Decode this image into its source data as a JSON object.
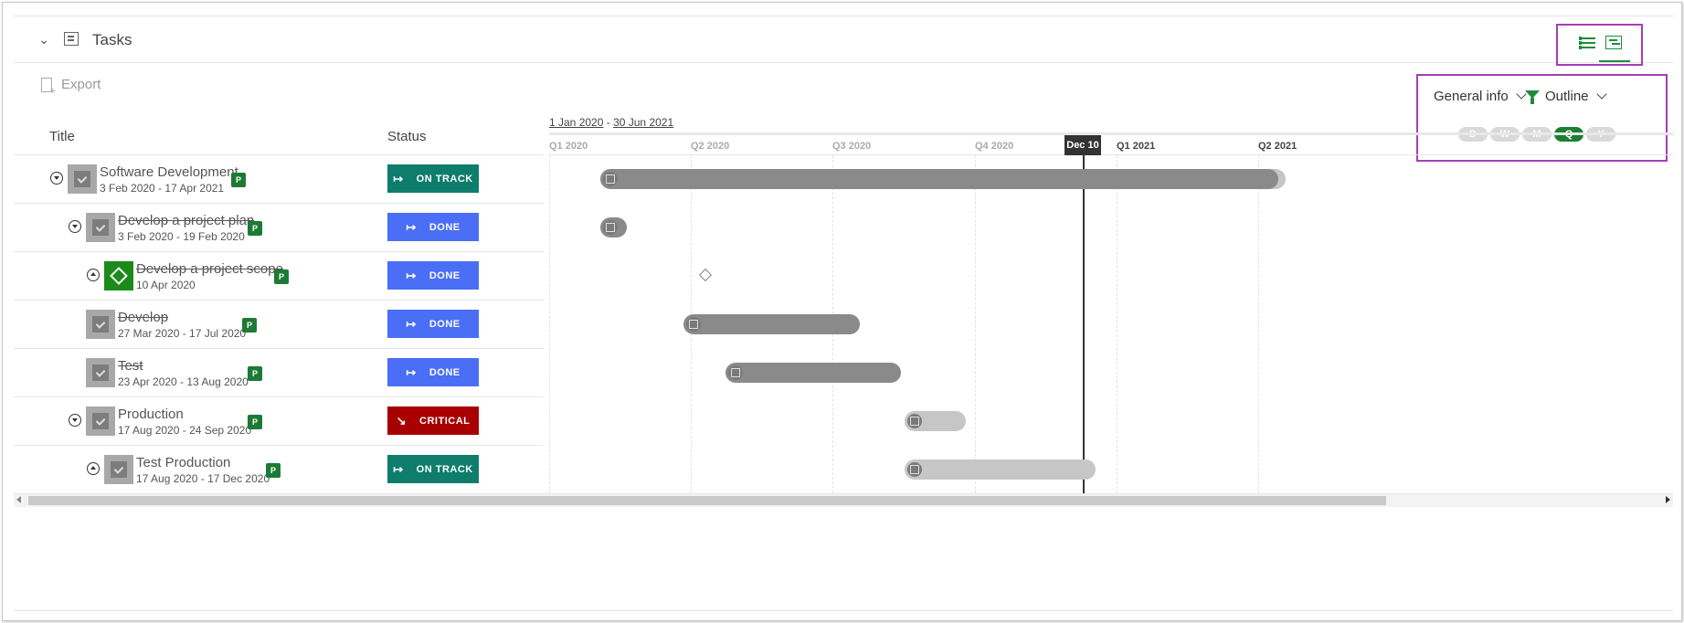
{
  "panel": {
    "title": "Tasks",
    "export_label": "Export"
  },
  "controls": {
    "info_label": "General info",
    "outline_label": "Outline",
    "scale": [
      "D",
      "W",
      "M",
      "Q",
      "Y"
    ],
    "scale_active": "Q"
  },
  "columns": {
    "title": "Title",
    "status": "Status"
  },
  "timeline": {
    "range_start": "1 Jan 2020",
    "range_separator": "-",
    "range_end": "30 Jun 2021",
    "quarters": [
      "Q1 2020",
      "Q2 2020",
      "Q3 2020",
      "Q4 2020",
      "Q1 2021",
      "Q2 2021"
    ],
    "today_label": "Dec 10"
  },
  "tasks": [
    {
      "name": "Software Development",
      "dates": "3 Feb 2020 - 17 Apr 2021",
      "status": "ON TRACK",
      "completed": false,
      "toggle": "down"
    },
    {
      "name": "Develop a project plan",
      "dates": "3 Feb 2020 - 19 Feb 2020",
      "status": "DONE",
      "completed": true,
      "toggle": "down"
    },
    {
      "name": "Develop a project scope",
      "dates": "10 Apr 2020",
      "status": "DONE",
      "completed": true,
      "toggle": "up"
    },
    {
      "name": "Develop",
      "dates": "27 Mar 2020 - 17 Jul 2020",
      "status": "DONE",
      "completed": true,
      "toggle": null
    },
    {
      "name": "Test",
      "dates": "23 Apr 2020 - 13 Aug 2020",
      "status": "DONE",
      "completed": true,
      "toggle": null
    },
    {
      "name": "Production",
      "dates": "17 Aug 2020 - 24 Sep 2020",
      "status": "CRITICAL",
      "completed": false,
      "toggle": "down"
    },
    {
      "name": "Test Production",
      "dates": "17 Aug 2020 - 17 Dec 2020",
      "status": "ON TRACK",
      "completed": false,
      "toggle": "up"
    }
  ],
  "icons": {
    "project_badge": "P"
  },
  "colors": {
    "accent": "#1e8c3a",
    "on_track": "#0e7d6c",
    "done": "#4a6ef5",
    "critical": "#a80000",
    "highlight": "#a43fb4"
  }
}
